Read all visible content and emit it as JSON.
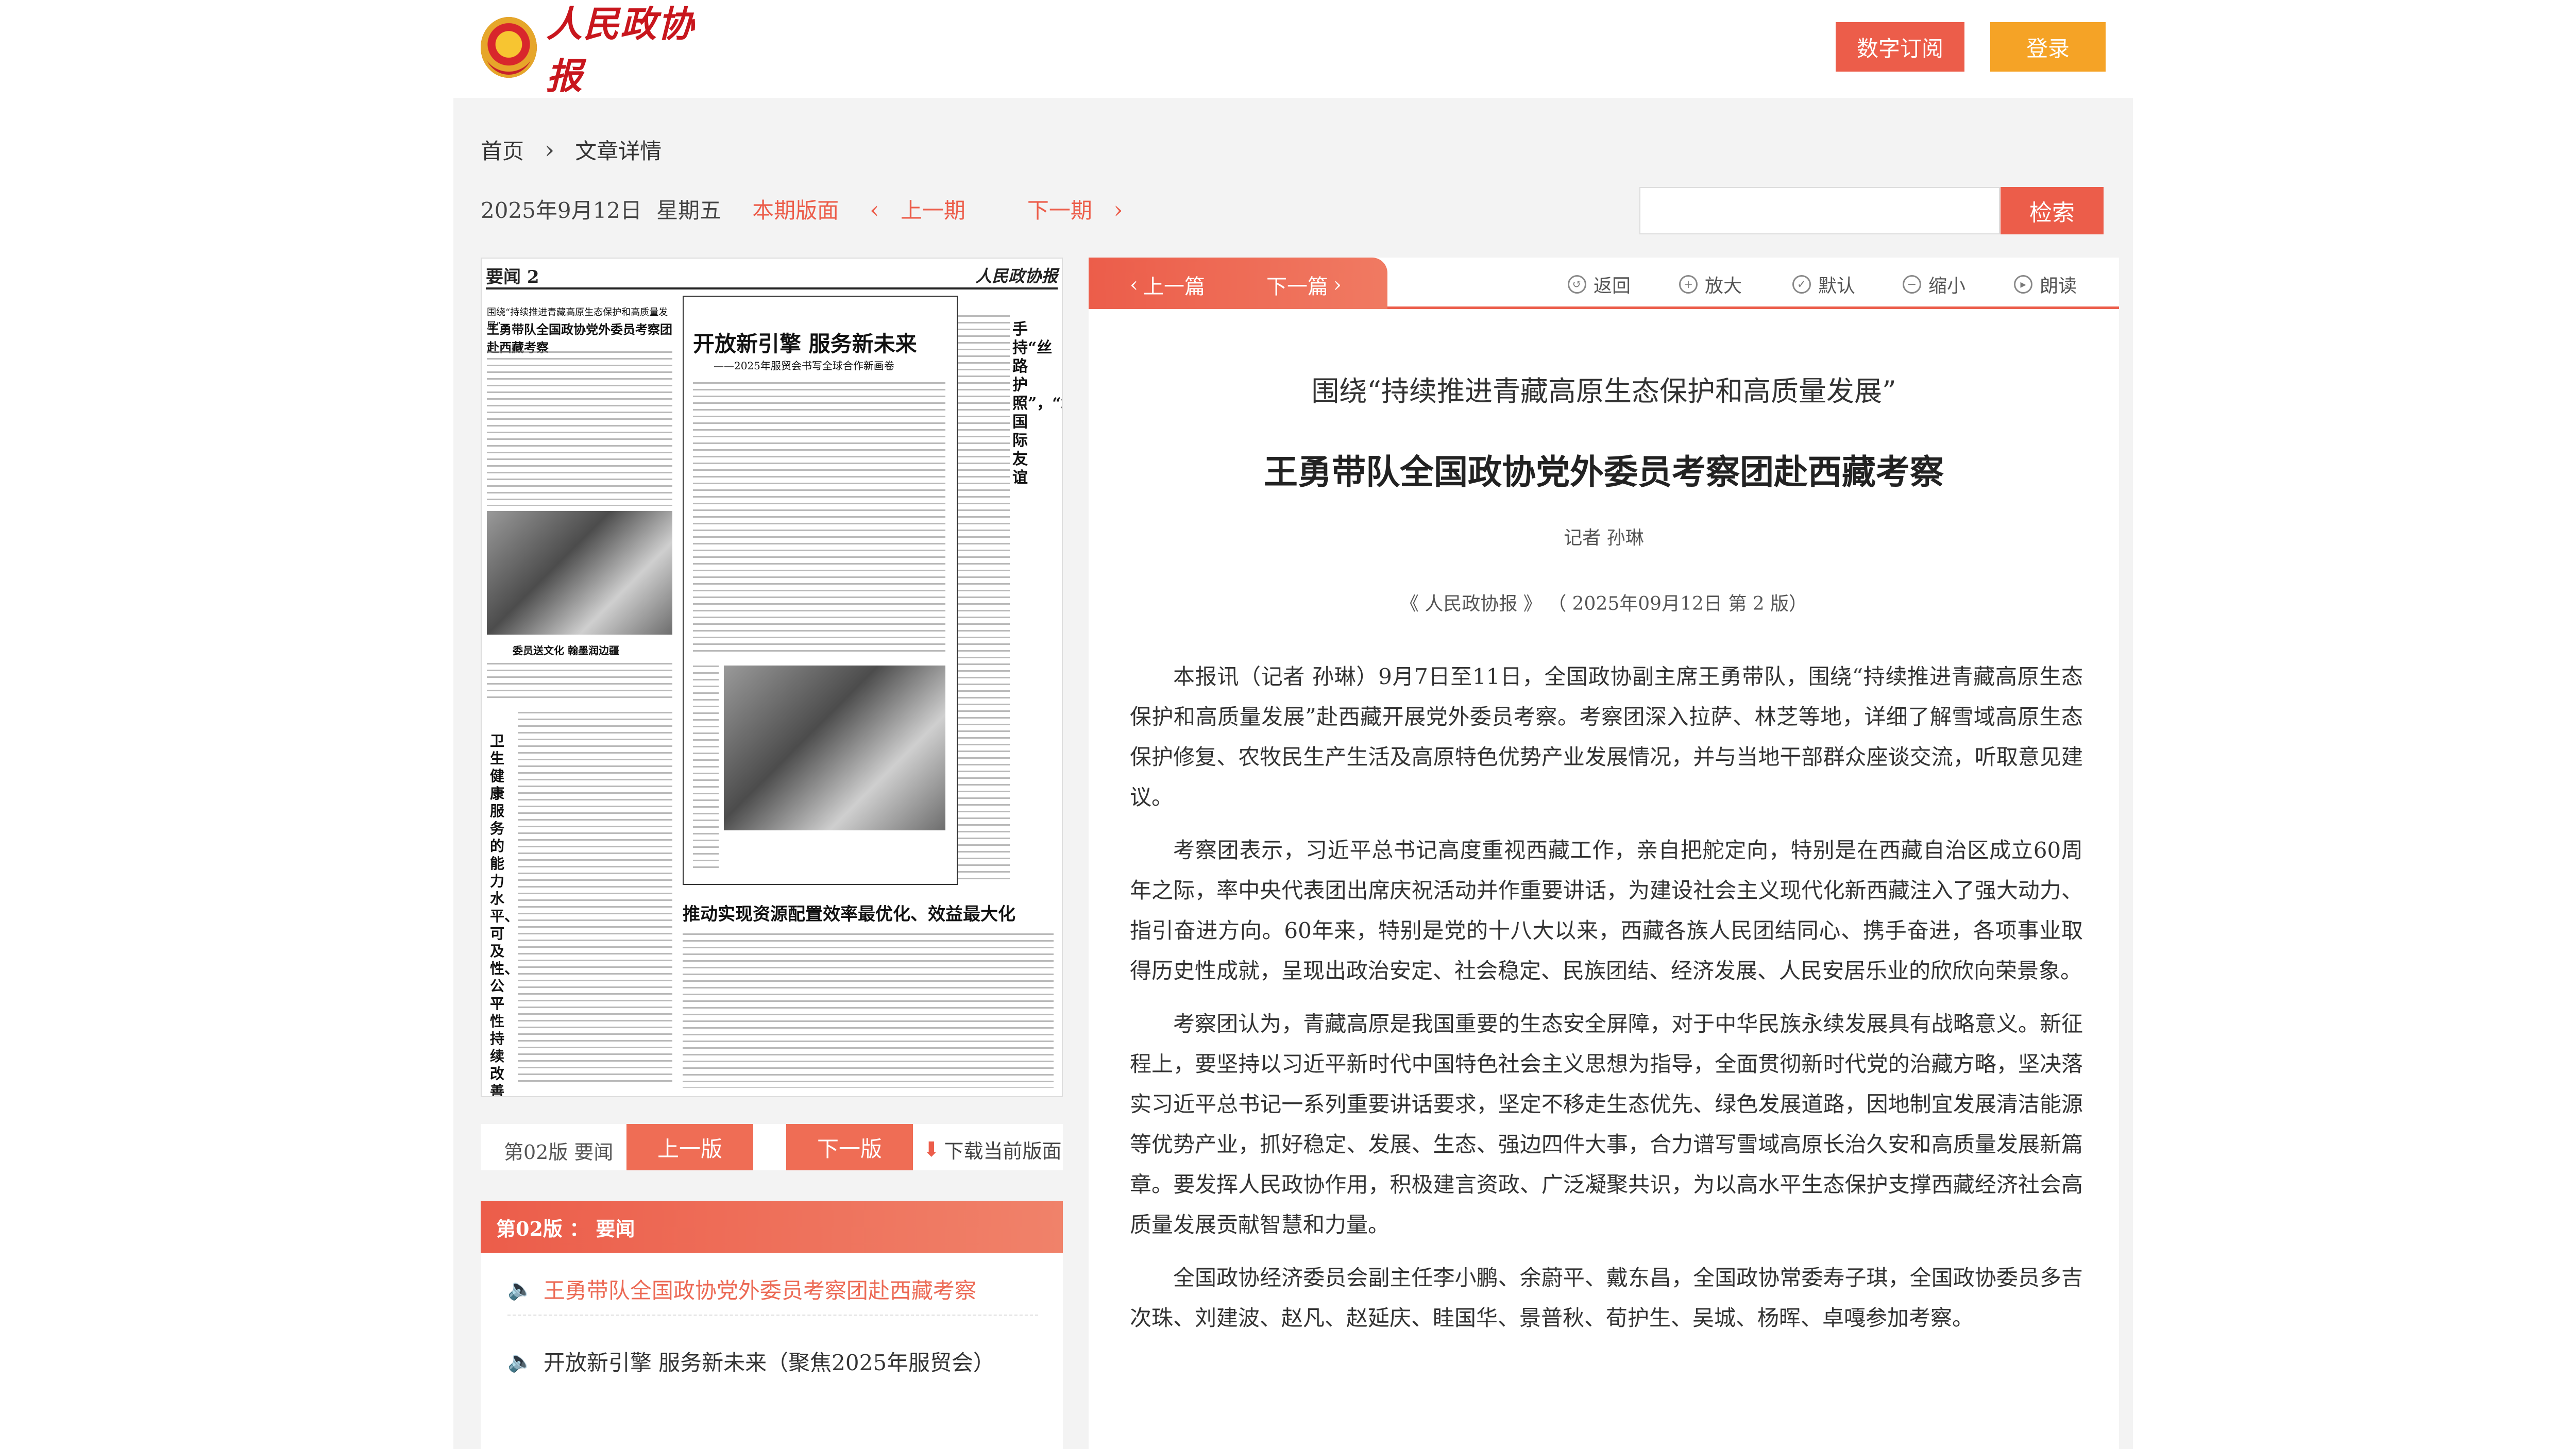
{
  "header": {
    "logo_text": "人民政协报",
    "subscribe_label": "数字订阅",
    "login_label": "登录"
  },
  "breadcrumb": {
    "home": "首页",
    "current": "文章详情"
  },
  "dateline": {
    "date": "2025年9月12日",
    "weekday": "星期五",
    "current_issue": "本期版面",
    "prev_issue": "上一期",
    "next_issue": "下一期"
  },
  "search": {
    "placeholder": "",
    "button_label": "检索"
  },
  "newspaper": {
    "section": "要闻 2",
    "brand": "人民政协报",
    "headline_main": "开放新引擎 服务新未来",
    "headline_sub": "——2025年服贸会书写全球合作新画卷",
    "headline_left": "王勇带队全国政协党外委员考察团赴西藏考察",
    "headline_left_pre": "围绕“持续推进青藏高原生态保护和高质量发展”",
    "headline_bottom": "推动实现资源配置效率最优化、效益最大化",
    "headline_vertical": "手持“丝路护照”，“章”显国际友谊",
    "headline_vertical_left": "卫生健康服务的能力水平、可及性、公平性持续改善和提升",
    "photo_caption": "委员送文化 翰墨润边疆"
  },
  "page_nav": {
    "page_label": "第02版  要闻",
    "prev_page": "上一版",
    "next_page": "下一版",
    "download": "下载当前版面"
  },
  "toc": {
    "header": "第02版 ： 要闻",
    "items": [
      {
        "title": "王勇带队全国政协党外委员考察团赴西藏考察"
      },
      {
        "title": "开放新引擎 服务新未来（聚焦2025年服贸会）"
      }
    ]
  },
  "article_toolbar": {
    "prev_article": "上一篇",
    "next_article": "下一篇",
    "back": "返回",
    "zoom_in": "放大",
    "default": "默认",
    "zoom_out": "缩小",
    "read_aloud": "朗读"
  },
  "article": {
    "subtitle": "围绕“持续推进青藏高原生态保护和高质量发展”",
    "title": "王勇带队全国政协党外委员考察团赴西藏考察",
    "author": "记者  孙琳",
    "source": "《  人民政协报  》  （  2025年09月12日   第  2  版）",
    "paragraphs": [
      "本报讯（记者 孙琳）9月7日至11日，全国政协副主席王勇带队，围绕“持续推进青藏高原生态保护和高质量发展”赴西藏开展党外委员考察。考察团深入拉萨、林芝等地，详细了解雪域高原生态保护修复、农牧民生产生活及高原特色优势产业发展情况，并与当地干部群众座谈交流，听取意见建议。",
      "考察团表示，习近平总书记高度重视西藏工作，亲自把舵定向，特别是在西藏自治区成立60周年之际，率中央代表团出席庆祝活动并作重要讲话，为建设社会主义现代化新西藏注入了强大动力、指引奋进方向。60年来，特别是党的十八大以来，西藏各族人民团结同心、携手奋进，各项事业取得历史性成就，呈现出政治安定、社会稳定、民族团结、经济发展、人民安居乐业的欣欣向荣景象。",
      "考察团认为，青藏高原是我国重要的生态安全屏障，对于中华民族永续发展具有战略意义。新征程上，要坚持以习近平新时代中国特色社会主义思想为指导，全面贯彻新时代党的治藏方略，坚决落实习近平总书记一系列重要讲话要求，坚定不移走生态优先、绿色发展道路，因地制宜发展清洁能源等优势产业，抓好稳定、发展、生态、强边四件大事，合力谱写雪域高原长治久安和高质量发展新篇章。要发挥人民政协作用，积极建言资政、广泛凝聚共识，为以高水平生态保护支撑西藏经济社会高质量发展贡献智慧和力量。",
      "全国政协经济委员会副主任李小鹏、余蔚平、戴东昌，全国政协常委寿子琪，全国政协委员多吉次珠、刘建波、赵凡、赵延庆、眭国华、景普秋、荀护生、吴城、杨晖、卓嘎参加考察。"
    ]
  },
  "colors": {
    "accent": "#ec5d4a",
    "login": "#f5a326",
    "background": "#f3f3f3"
  }
}
